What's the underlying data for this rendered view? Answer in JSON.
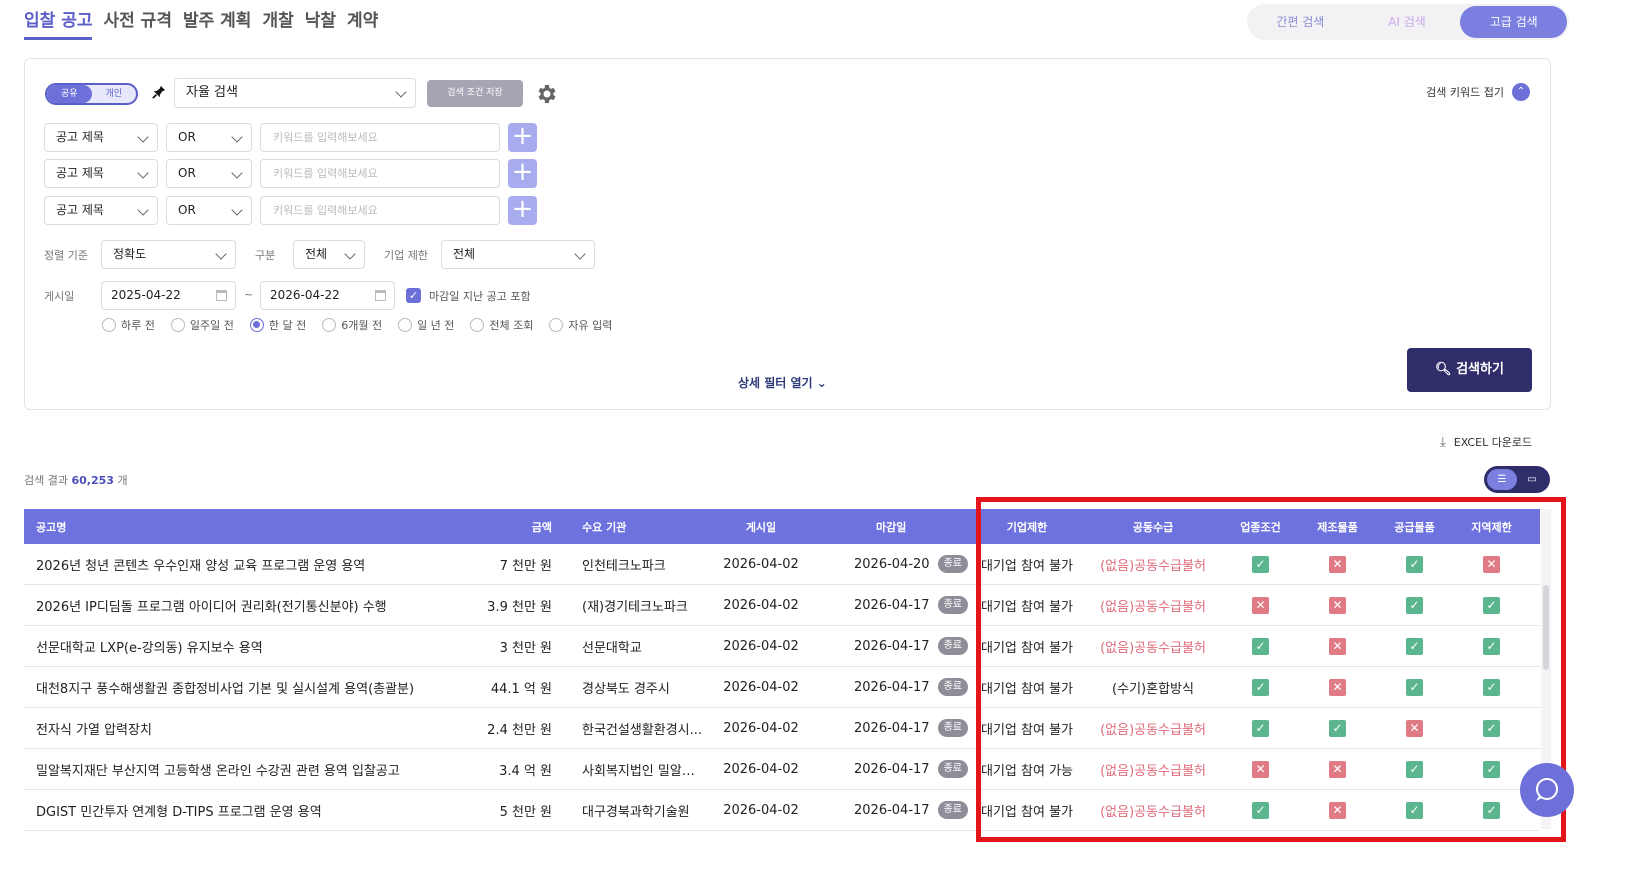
{
  "top_tabs": [
    "입찰 공고",
    "사전 규격",
    "발주 계획",
    "개찰",
    "낙찰",
    "계약"
  ],
  "search_modes": [
    "간편 검색",
    "AI 검색",
    "고급 검색"
  ],
  "panel": {
    "share_options": [
      "공유",
      "개인"
    ],
    "preset": "자율 검색",
    "save_condition": "검색 조건 저장",
    "keyword_fold": "검색 키워드 접기",
    "keyword_rows": [
      {
        "field": "공고 제목",
        "op": "OR",
        "placeholder": "키워드를 입력해보세요"
      },
      {
        "field": "공고 제목",
        "op": "OR",
        "placeholder": "키워드를 입력해보세요"
      },
      {
        "field": "공고 제목",
        "op": "OR",
        "placeholder": "키워드를 입력해보세요"
      }
    ],
    "sort_label": "정렬 기준",
    "sort_value": "정확도",
    "category_label": "구분",
    "category_value": "전체",
    "corp_label": "기업 제한",
    "corp_value": "전체",
    "posted_label": "게시일",
    "date_from": "2025-04-22",
    "date_sep": "~",
    "date_to": "2026-04-22",
    "include_closed": "마감일 지난 공고 포함",
    "ranges": [
      "하루 전",
      "일주일 전",
      "한 달 전",
      "6개월 전",
      "일 년 전",
      "전체 조회",
      "자유 입력"
    ],
    "detail_filter": "상세 필터 열기",
    "search_button": "검색하기"
  },
  "excel_download": "EXCEL 다운로드",
  "result": {
    "prefix": "검색 결과",
    "count": "60,253",
    "suffix": "개"
  },
  "columns": [
    "공고명",
    "금액",
    "수요 기관",
    "게시일",
    "마감일",
    "기업제한",
    "공동수급",
    "업종조건",
    "제조물품",
    "공급물품",
    "지역제한"
  ],
  "rows": [
    {
      "title": "2026년 청년 콘텐츠 우수인재 양성 교육 프로그램 운영 용역",
      "amount": "7 천만 원",
      "org": "인천테크노파크",
      "posted": "2026-04-02",
      "closing": "2026-04-20",
      "status": "종료",
      "corp": "대기업 참여 불가",
      "joint": "(없음)공동수급불허",
      "checks": [
        true,
        false,
        true,
        false
      ]
    },
    {
      "title": "2026년 IP디딤돌 프로그램 아이디어 권리화(전기통신분야) 수행",
      "amount": "3.9 천만 원",
      "org": "(재)경기테크노파크",
      "posted": "2026-04-02",
      "closing": "2026-04-17",
      "status": "종료",
      "corp": "대기업 참여 불가",
      "joint": "(없음)공동수급불허",
      "checks": [
        false,
        false,
        true,
        true
      ]
    },
    {
      "title": "선문대학교 LXP(e-강의동) 유지보수 용역",
      "amount": "3 천만 원",
      "org": "선문대학교",
      "posted": "2026-04-02",
      "closing": "2026-04-17",
      "status": "종료",
      "corp": "대기업 참여 불가",
      "joint": "(없음)공동수급불허",
      "checks": [
        true,
        false,
        true,
        true
      ]
    },
    {
      "title": "대천8지구 풍수해생활권 종합정비사업 기본 및 실시설계 용역(총괄분)",
      "amount": "44.1 억 원",
      "org": "경상북도 경주시",
      "posted": "2026-04-02",
      "closing": "2026-04-17",
      "status": "종료",
      "corp": "대기업 참여 불가",
      "joint": "(수기)혼합방식",
      "checks": [
        true,
        false,
        true,
        true
      ]
    },
    {
      "title": "전자식 가열 압력장치",
      "amount": "2.4 천만 원",
      "org": "한국건설생활환경시...",
      "posted": "2026-04-02",
      "closing": "2026-04-17",
      "status": "종료",
      "corp": "대기업 참여 불가",
      "joint": "(없음)공동수급불허",
      "checks": [
        true,
        true,
        false,
        true
      ]
    },
    {
      "title": "밀알복지재단 부산지역 고등학생 온라인 수강권 관련 용역 입찰공고",
      "amount": "3.4 억 원",
      "org": "사회복지법인 밀알복...",
      "posted": "2026-04-02",
      "closing": "2026-04-17",
      "status": "종료",
      "corp": "대기업 참여 가능",
      "joint": "(없음)공동수급불허",
      "checks": [
        false,
        false,
        true,
        true
      ]
    },
    {
      "title": "DGIST 민간투자 연계형 D-TIPS 프로그램 운영 용역",
      "amount": "5 천만 원",
      "org": "대구경북과학기술원",
      "posted": "2026-04-02",
      "closing": "2026-04-17",
      "status": "종료",
      "corp": "대기업 참여 불가",
      "joint": "(없음)공동수급불허",
      "checks": [
        true,
        false,
        true,
        true
      ]
    }
  ],
  "colors": {
    "accent": "#6e72de",
    "dark": "#2f2e6a",
    "ok": "#5bb58f",
    "no": "#e07b86",
    "highlight": "#e4141b"
  }
}
